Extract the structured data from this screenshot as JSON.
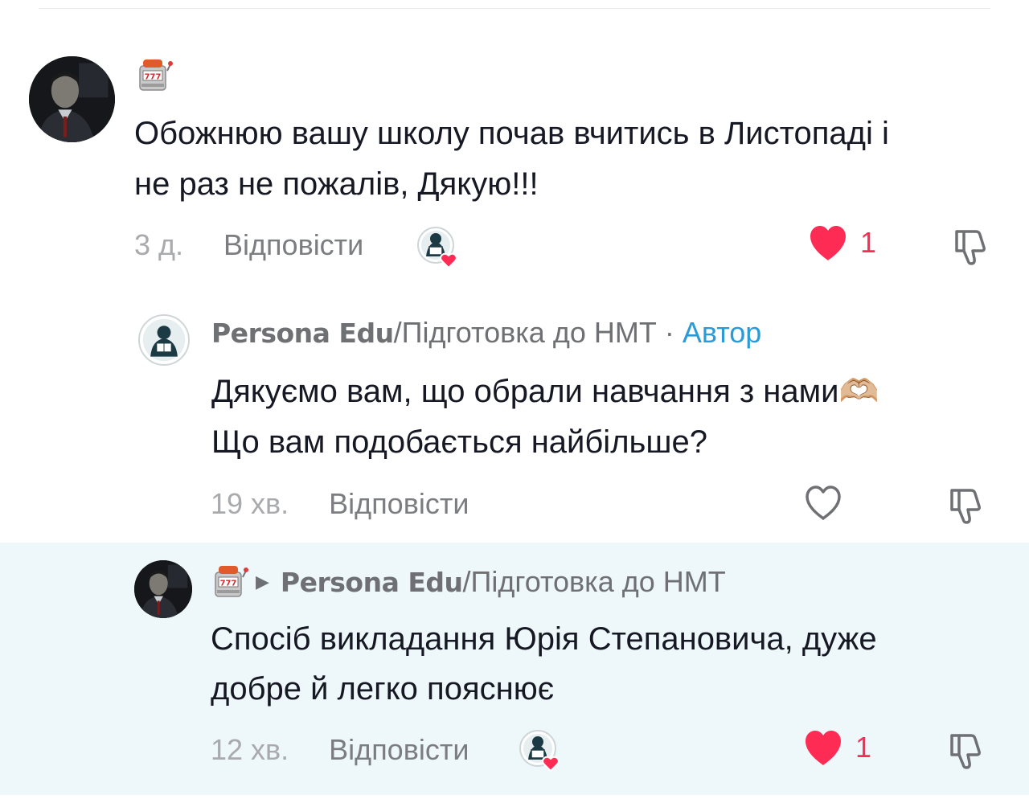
{
  "comments": [
    {
      "user_emoji": "slot-machine",
      "text_line1": "Обожнюю вашу школу почав вчитись в Листопаді і",
      "text_line2": "не раз не пожалів, Дякую!!!",
      "time": "3 д.",
      "reply_label": "Відповісти",
      "liked_by_creator": true,
      "likes": "1",
      "liked": true
    },
    {
      "author_brand": "Persona Edu",
      "author_rest": "/Підготовка до НМТ",
      "separator": "·",
      "author_badge": "Автор",
      "text_line1": "Дякуємо вам, що обрали навчання з нами🫶🏼",
      "text_line2": "Що вам подобається найбільше?",
      "time": "19 хв.",
      "reply_label": "Відповісти",
      "liked": false
    },
    {
      "user_emoji": "slot-machine",
      "reply_to_brand": "Persona Edu",
      "reply_to_rest": "/Підготовка до НМТ",
      "text_line1": "Спосіб викладання Юрія Степановича, дуже",
      "text_line2": "добре й легко пояснює",
      "time": "12 хв.",
      "reply_label": "Відповісти",
      "liked_by_creator": true,
      "likes": "1",
      "liked": true
    }
  ],
  "colors": {
    "like_red": "#fe2c55",
    "author_blue": "#2b9bd6",
    "highlight_bg": "#eef8fb",
    "muted_text": "#a9aaad"
  }
}
